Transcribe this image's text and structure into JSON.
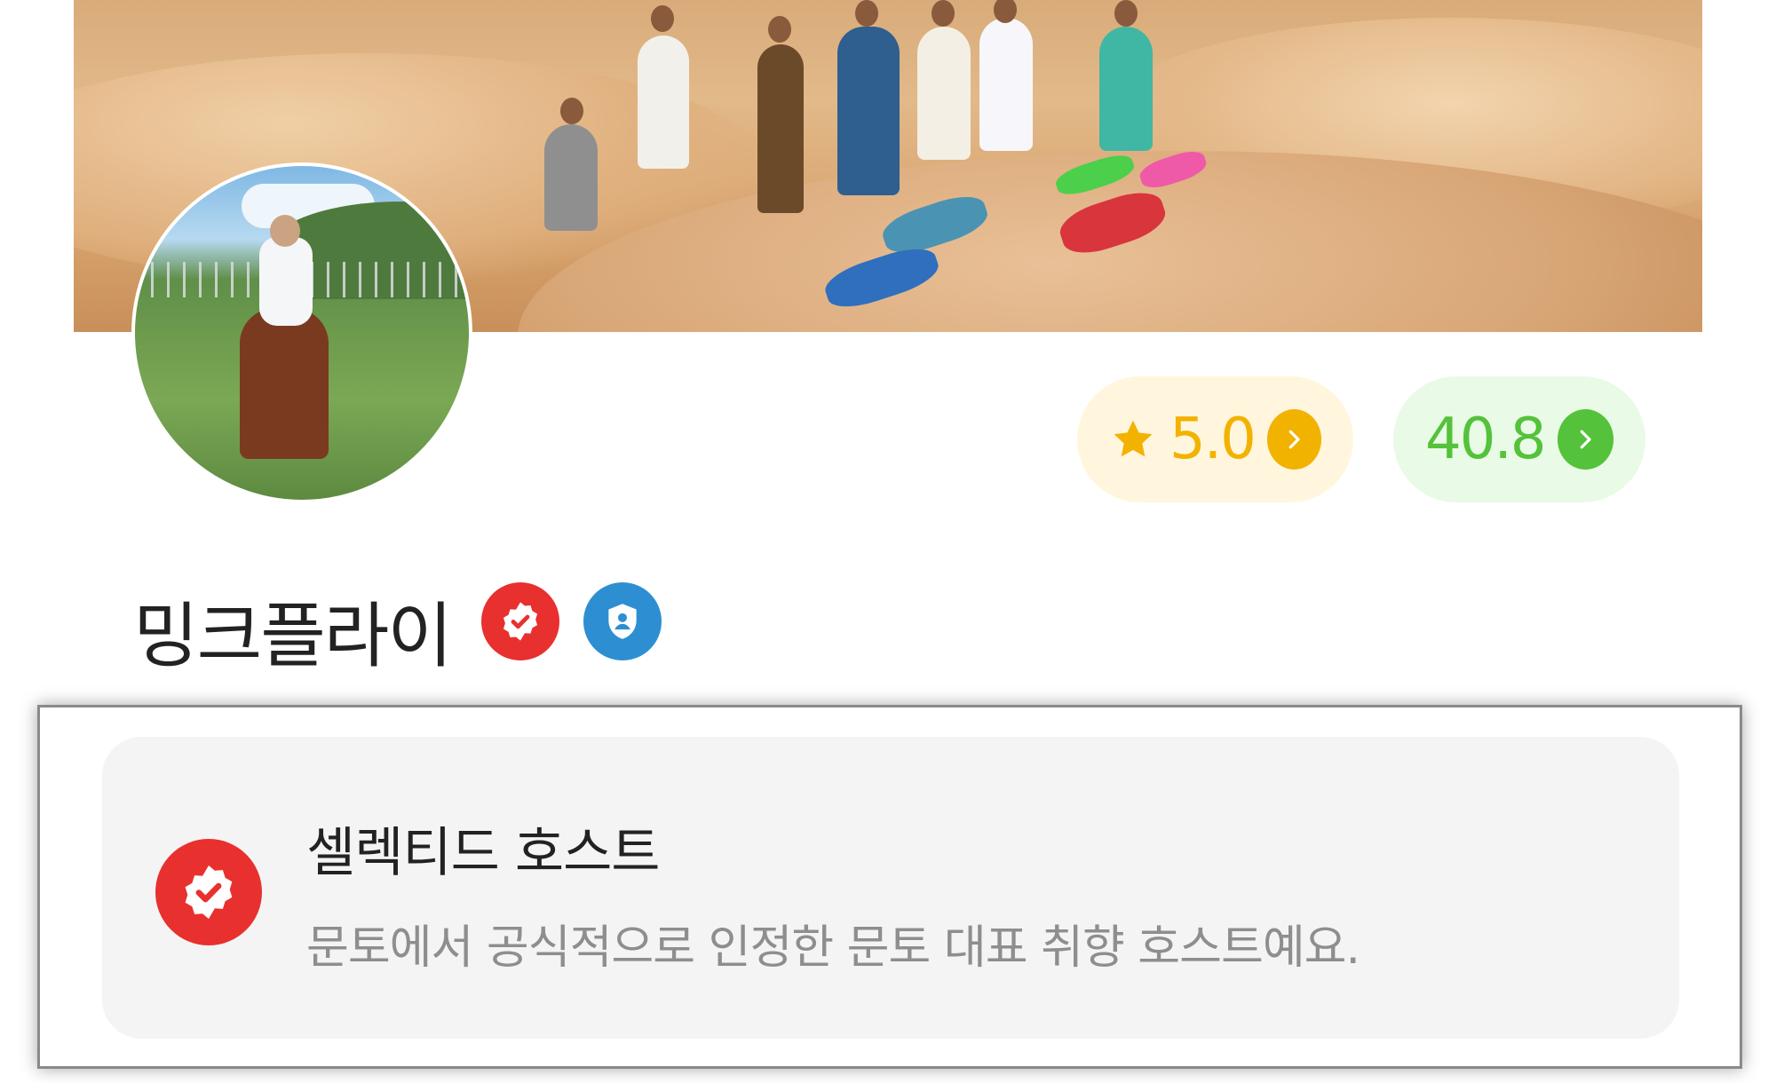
{
  "profile": {
    "name": "밍크플라이",
    "rating": {
      "value": "5.0",
      "icon": "star-icon"
    },
    "temperature": {
      "value": "40.8"
    }
  },
  "badges": [
    {
      "icon": "selected-host-badge-icon",
      "color": "#e8302e"
    },
    {
      "icon": "verified-id-badge-icon",
      "color": "#2d8fd1"
    }
  ],
  "selected_host_popup": {
    "title": "셀렉티드 호스트",
    "description": "문토에서 공식적으로 인정한 문토 대표 취향 호스트예요."
  },
  "colors": {
    "rating_accent": "#f2b200",
    "temperature_accent": "#54c23a",
    "badge_red": "#e8302e",
    "badge_blue": "#2d8fd1"
  }
}
